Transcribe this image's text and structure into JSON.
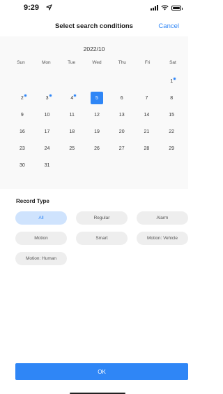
{
  "status": {
    "time": "9:29"
  },
  "header": {
    "title": "Select search conditions",
    "cancel_label": "Cancel"
  },
  "calendar": {
    "month_label": "2022/10",
    "weekdays": [
      "Sun",
      "Mon",
      "Tue",
      "Wed",
      "Thu",
      "Fri",
      "Sat"
    ],
    "days": [
      {
        "label": ""
      },
      {
        "label": ""
      },
      {
        "label": ""
      },
      {
        "label": ""
      },
      {
        "label": ""
      },
      {
        "label": ""
      },
      {
        "label": "1",
        "marked": true
      },
      {
        "label": "2",
        "marked": true
      },
      {
        "label": "3",
        "marked": true
      },
      {
        "label": "4",
        "marked": true
      },
      {
        "label": "5",
        "selected": true
      },
      {
        "label": "6"
      },
      {
        "label": "7"
      },
      {
        "label": "8"
      },
      {
        "label": "9"
      },
      {
        "label": "10"
      },
      {
        "label": "11"
      },
      {
        "label": "12"
      },
      {
        "label": "13"
      },
      {
        "label": "14"
      },
      {
        "label": "15"
      },
      {
        "label": "16"
      },
      {
        "label": "17"
      },
      {
        "label": "18"
      },
      {
        "label": "19"
      },
      {
        "label": "20"
      },
      {
        "label": "21"
      },
      {
        "label": "22"
      },
      {
        "label": "23"
      },
      {
        "label": "24"
      },
      {
        "label": "25"
      },
      {
        "label": "26"
      },
      {
        "label": "27"
      },
      {
        "label": "28"
      },
      {
        "label": "29"
      },
      {
        "label": "30"
      },
      {
        "label": "31"
      }
    ]
  },
  "record_type": {
    "title": "Record Type",
    "options": [
      {
        "label": "All",
        "active": true
      },
      {
        "label": "Regular"
      },
      {
        "label": "Alarm"
      },
      {
        "label": "Motion"
      },
      {
        "label": "Smart"
      },
      {
        "label": "Motion: Vehicle"
      },
      {
        "label": "Motion: Human"
      }
    ]
  },
  "ok_label": "OK",
  "colors": {
    "accent": "#2f86f6",
    "chip_bg": "#eeeeee",
    "chip_active_bg": "#cfe3fd"
  }
}
